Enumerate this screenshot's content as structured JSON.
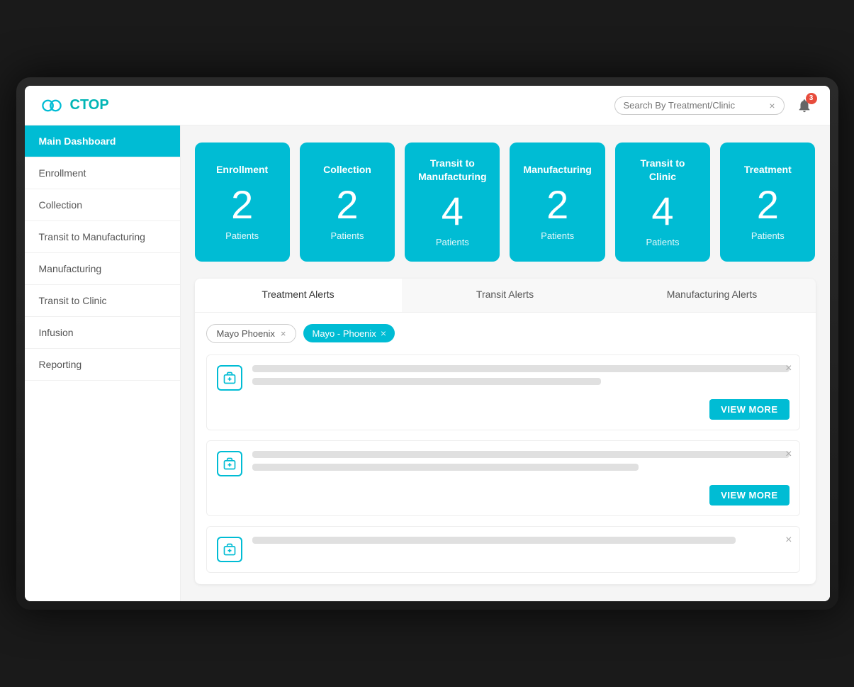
{
  "header": {
    "logo_text": "CTOP",
    "search_placeholder": "Search By Treatment/Clinic",
    "notification_count": "3"
  },
  "sidebar": {
    "items": [
      {
        "label": "Main Dashboard",
        "active": true
      },
      {
        "label": "Enrollment",
        "active": false
      },
      {
        "label": "Collection",
        "active": false
      },
      {
        "label": "Transit to Manufacturing",
        "active": false
      },
      {
        "label": "Manufacturing",
        "active": false
      },
      {
        "label": "Transit to Clinic",
        "active": false
      },
      {
        "label": "Infusion",
        "active": false
      },
      {
        "label": "Reporting",
        "active": false
      }
    ]
  },
  "stat_cards": [
    {
      "title": "Enrollment",
      "number": "2",
      "label": "Patients"
    },
    {
      "title": "Collection",
      "number": "2",
      "label": "Patients"
    },
    {
      "title": "Transit to Manufacturing",
      "number": "4",
      "label": "Patients"
    },
    {
      "title": "Manufacturing",
      "number": "2",
      "label": "Patients"
    },
    {
      "title": "Transit to Clinic",
      "number": "4",
      "label": "Patients"
    },
    {
      "title": "Treatment",
      "number": "2",
      "label": "Patients"
    }
  ],
  "tabs": {
    "items": [
      {
        "label": "Treatment Alerts",
        "active": true
      },
      {
        "label": "Transit Alerts",
        "active": false
      },
      {
        "label": "Manufacturing Alerts",
        "active": false
      }
    ]
  },
  "filter": {
    "dropdown_value": "Mayo Phoenix",
    "tag_label": "Mayo - Phoenix"
  },
  "alerts": [
    {
      "id": 1
    },
    {
      "id": 2
    },
    {
      "id": 3
    }
  ],
  "buttons": {
    "view_more": "VIEW MORE",
    "clear_search": "×",
    "close_alert": "×",
    "remove_filter": "×"
  },
  "colors": {
    "teal": "#00bcd4",
    "red": "#e74c3c"
  }
}
